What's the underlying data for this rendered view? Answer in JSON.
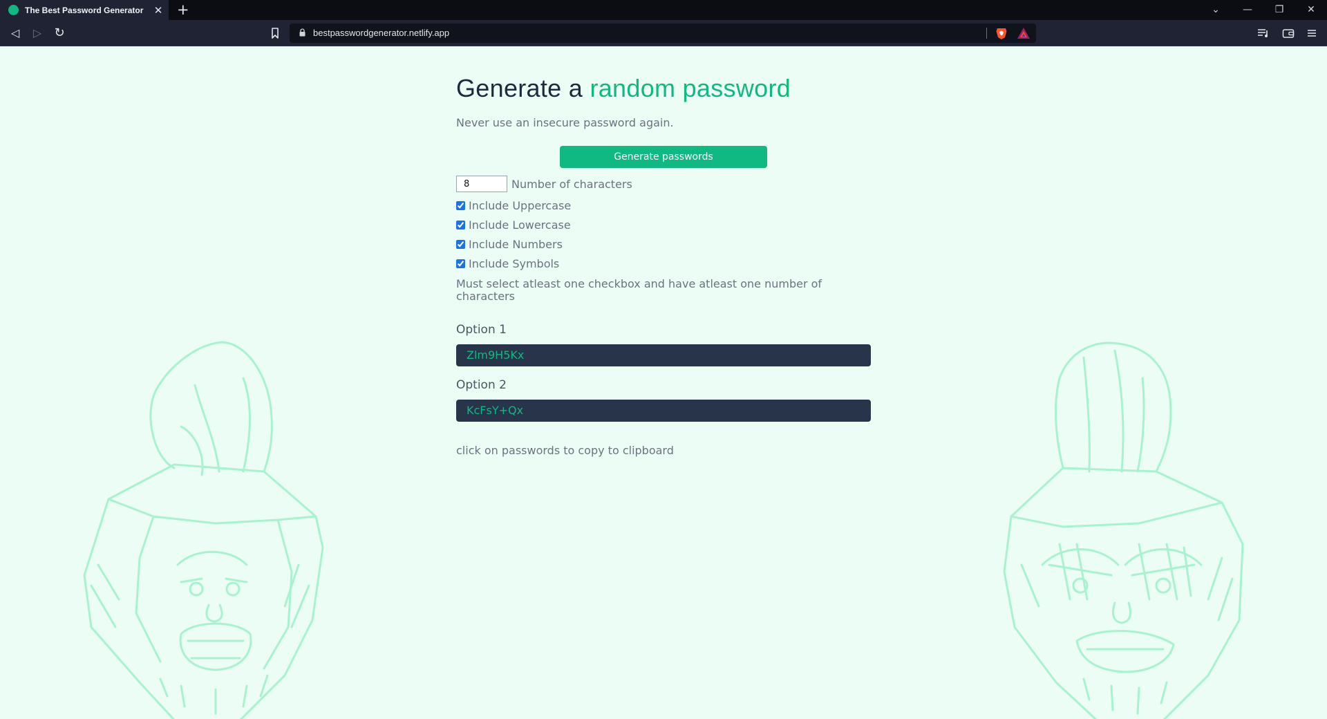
{
  "browser": {
    "tab_title": "The Best Password Generator",
    "tab_close": "✕",
    "new_tab": "+",
    "url": "bestpasswordgenerator.netlify.app",
    "nav": {
      "back": "◁",
      "forward": "▷",
      "reload": "↻"
    },
    "window": {
      "list": "⌄",
      "minimize": "—",
      "restore": "❐",
      "close": "✕"
    }
  },
  "page": {
    "title_part1": "Generate a ",
    "title_accent": "random password",
    "subtitle": "Never use an insecure password again.",
    "generate_button": "Generate passwords",
    "length": {
      "value": "8",
      "label": "Number of characters"
    },
    "checkboxes": [
      {
        "label": "Include Uppercase",
        "checked": true
      },
      {
        "label": "Include Lowercase",
        "checked": true
      },
      {
        "label": "Include Numbers",
        "checked": true
      },
      {
        "label": "Include Symbols",
        "checked": true
      }
    ],
    "warning": "Must select atleast one checkbox and have atleast one number of characters",
    "options": [
      {
        "label": "Option 1",
        "password": "Zlm9H5Kx"
      },
      {
        "label": "Option 2",
        "password": "KcFsY+Qx"
      }
    ],
    "hint": "click on passwords to copy to clipboard"
  },
  "colors": {
    "accent": "#10b981",
    "page_bg": "#ecfdf5",
    "password_bg": "#273449",
    "illustration": "#a7f3d0"
  },
  "icons": [
    "bookmark-icon",
    "lock-icon",
    "brave-lion-icon",
    "bat-rewards-icon",
    "playlist-icon",
    "wallet-icon",
    "menu-icon"
  ]
}
